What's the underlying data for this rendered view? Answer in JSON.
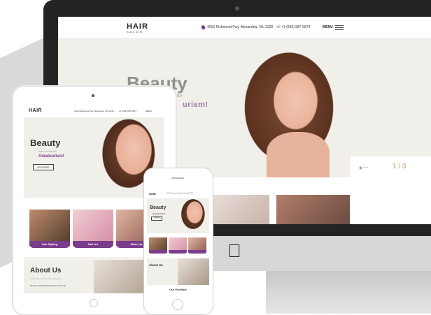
{
  "site": {
    "logo": "HAIR",
    "logo_sub": "SALON",
    "address": "4016 Richmond Fwy, Alexandria, VA, 2230",
    "phone": "+1 (609) 987-5874",
    "menu_label": "MENU"
  },
  "desktop": {
    "hero_title": "Beauty",
    "hero_sub1": "ate",
    "hero_sub2": "urism!",
    "slide_counter": "1 / 3"
  },
  "tablet": {
    "hero_title": "Beauty",
    "hero_sub1": "does not tolerate",
    "hero_sub2": "Amateurism!",
    "cta_label": "get template",
    "services": [
      "Hair Styling",
      "Nail Art",
      "Make Up"
    ],
    "about_title": "About Us",
    "about_text": "Lorem ipsum dolor sit amet consectetur",
    "hours": "Weekdays: 8:00-20:00    Weekends: 9:00-19:00"
  },
  "phone": {
    "hero_title": "Beauty",
    "hero_sub2": "Amateurism!",
    "cta_label": "get template",
    "about_title": "About Us",
    "portfolio_title": "Our Portfolio"
  },
  "colors": {
    "accent": "#7b3c8c",
    "hero_bg": "#f1efea",
    "monitor_bezel": "#232323"
  }
}
